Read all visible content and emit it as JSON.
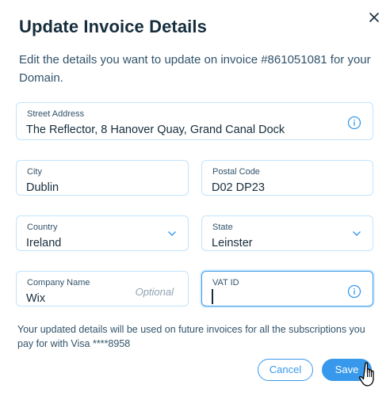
{
  "dialog": {
    "title": "Update Invoice Details",
    "subtitle": "Edit the details you want to update on invoice #861051081 for your Domain.",
    "footer_note": "Your updated details will be used on future invoices for all the subscriptions you pay for with Visa ****8958"
  },
  "fields": {
    "street": {
      "label": "Street Address",
      "value": "The Reflector, 8 Hanover Quay, Grand Canal Dock"
    },
    "city": {
      "label": "City",
      "value": "Dublin"
    },
    "postal": {
      "label": "Postal Code",
      "value": "D02 DP23"
    },
    "country": {
      "label": "Country",
      "value": "Ireland"
    },
    "state": {
      "label": "State",
      "value": "Leinster"
    },
    "company": {
      "label": "Company Name",
      "value": "Wix",
      "hint": "Optional"
    },
    "vat": {
      "label": "VAT ID",
      "value": ""
    }
  },
  "buttons": {
    "cancel": "Cancel",
    "save": "Save"
  },
  "icons": {
    "close": "close-icon",
    "info": "info-icon",
    "chevron": "chevron-down-icon",
    "pointer": "hand-pointer-cursor"
  },
  "colors": {
    "accent": "#3899ec",
    "border": "#c1e4fe",
    "text": "#162d3d",
    "secondary_text": "#32536a"
  }
}
